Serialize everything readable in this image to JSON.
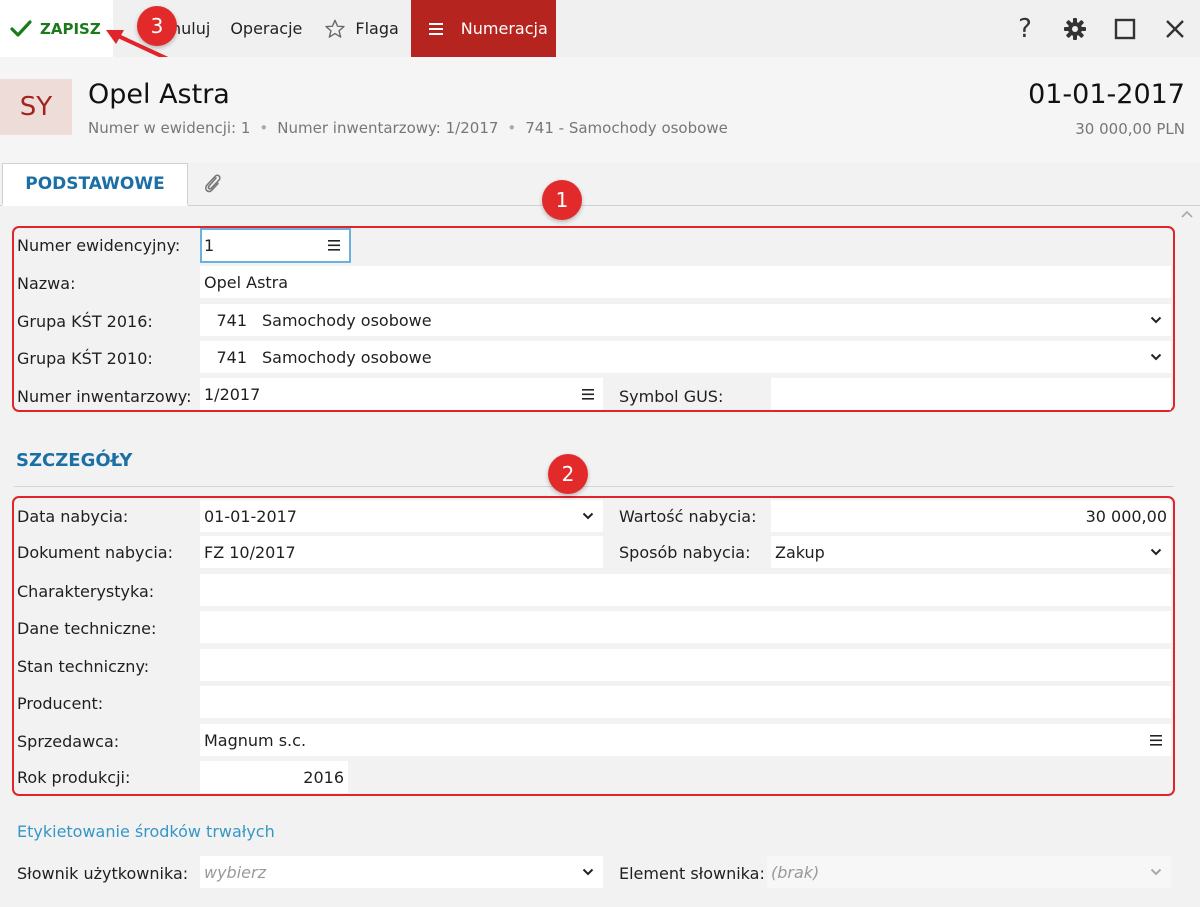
{
  "toolbar": {
    "save_label": "ZAPISZ",
    "cancel_label": "nuluj",
    "operations_label": "Operacje",
    "flag_label": "Flaga",
    "numbering_label": "Numeracja",
    "help_glyph": "?",
    "icons": [
      "check-icon",
      "star-icon",
      "menu-icon",
      "help-icon",
      "gear-icon",
      "maximize-icon",
      "close-icon"
    ]
  },
  "header": {
    "avatar": "SY",
    "title": "Opel Astra",
    "meta": [
      "Numer w ewidencji: 1",
      "Numer inwentarzowy: 1/2017",
      "741 - Samochody osobowe"
    ],
    "date": "01-01-2017",
    "amount": "30 000,00 PLN"
  },
  "tabs": {
    "basic": "PODSTAWOWE"
  },
  "basic": {
    "numer_ewidencyjny": {
      "label": "Numer ewidencyjny:",
      "value": "1"
    },
    "nazwa": {
      "label": "Nazwa:",
      "value": "Opel Astra"
    },
    "grupa_kst_2016": {
      "label": "Grupa KŚT 2016:",
      "code": "741",
      "value": "Samochody osobowe"
    },
    "grupa_kst_2010": {
      "label": "Grupa KŚT 2010:",
      "code": "741",
      "value": "Samochody osobowe"
    },
    "numer_inwentarzowy": {
      "label": "Numer inwentarzowy:",
      "value": "1/2017"
    },
    "symbol_gus": {
      "label": "Symbol GUS:",
      "value": ""
    }
  },
  "details": {
    "title": "SZCZEGÓŁY",
    "data_nabycia": {
      "label": "Data nabycia:",
      "value": "01-01-2017"
    },
    "wartosc_nabycia": {
      "label": "Wartość nabycia:",
      "value": "30 000,00"
    },
    "dokument_nabycia": {
      "label": "Dokument nabycia:",
      "value": "FZ 10/2017"
    },
    "sposob_nabycia": {
      "label": "Sposób nabycia:",
      "value": "Zakup"
    },
    "charakterystyka": {
      "label": "Charakterystyka:",
      "value": ""
    },
    "dane_techniczne": {
      "label": "Dane techniczne:",
      "value": ""
    },
    "stan_techniczny": {
      "label": "Stan techniczny:",
      "value": ""
    },
    "producent": {
      "label": "Producent:",
      "value": ""
    },
    "sprzedawca": {
      "label": "Sprzedawca:",
      "value": "Magnum s.c."
    },
    "rok_produkcji": {
      "label": "Rok produkcji:",
      "value": "2016"
    }
  },
  "labeling": {
    "link": "Etykietowanie środków trwałych",
    "slownik": {
      "label": "Słownik użytkownika:",
      "placeholder": "wybierz"
    },
    "element": {
      "label": "Element słownika:",
      "placeholder": "(brak)"
    }
  },
  "annotations": {
    "badge1": "1",
    "badge2": "2",
    "badge3": "3"
  },
  "colors": {
    "accent": "#1a6fa5",
    "brand_red": "#b5241e",
    "annotation": "#e0242a",
    "save_green": "#1c7a1c"
  }
}
